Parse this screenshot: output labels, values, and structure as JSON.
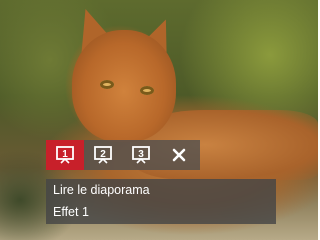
{
  "slideshow_icons": [
    {
      "name": "slideshow-1-icon",
      "number": "1",
      "selected": true
    },
    {
      "name": "slideshow-2-icon",
      "number": "2",
      "selected": false
    },
    {
      "name": "slideshow-3-icon",
      "number": "3",
      "selected": false
    },
    {
      "name": "close-icon",
      "number": "",
      "selected": false
    }
  ],
  "menu": {
    "title": "Lire le diaporama",
    "value": "Effet 1"
  },
  "colors": {
    "selected": "#c8202a",
    "bar_bg": "#505050",
    "text": "#ffffff"
  }
}
